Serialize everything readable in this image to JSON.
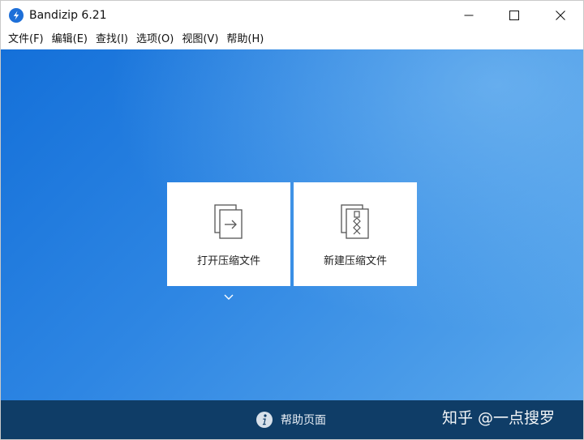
{
  "window": {
    "title": "Bandizip 6.21",
    "icons": {
      "app": "bandizip-logo-icon",
      "minimize": "minimize-icon",
      "maximize": "maximize-icon",
      "close": "close-icon"
    }
  },
  "menu": {
    "items": [
      {
        "label": "文件(F)"
      },
      {
        "label": "编辑(E)"
      },
      {
        "label": "查找(I)"
      },
      {
        "label": "选项(O)"
      },
      {
        "label": "视图(V)"
      },
      {
        "label": "帮助(H)"
      }
    ]
  },
  "main": {
    "open_archive": {
      "label": "打开压缩文件",
      "icon": "open-archive-icon"
    },
    "new_archive": {
      "label": "新建压缩文件",
      "icon": "zip-file-icon"
    },
    "expand_icon": "chevron-down-icon"
  },
  "footer": {
    "help_label": "帮助页面",
    "help_icon": "info-icon",
    "watermark": "知乎 @一点搜罗"
  },
  "colors": {
    "accent_blue": "#1470d9",
    "footer_bg": "#0f3d67",
    "card_bg": "#ffffff"
  }
}
